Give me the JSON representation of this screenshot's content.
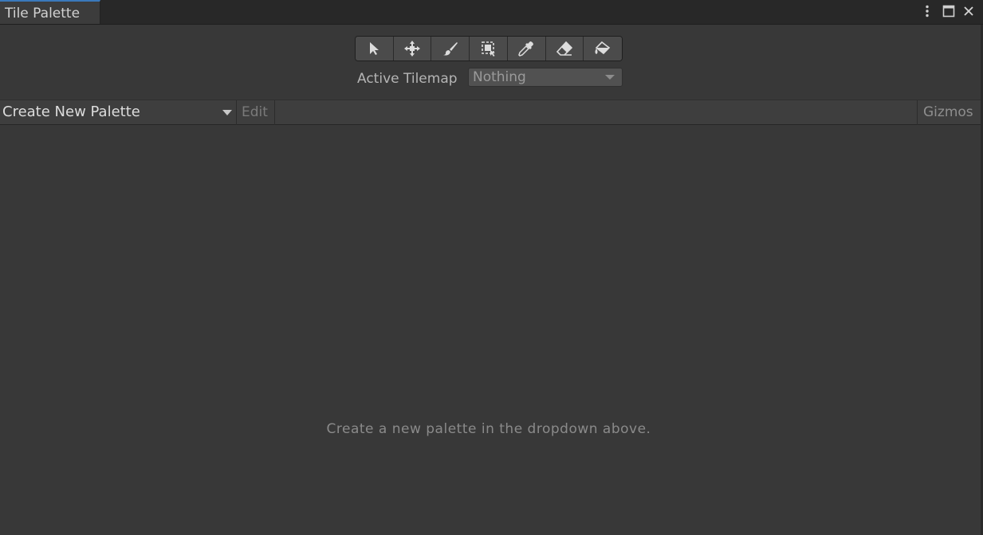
{
  "window": {
    "tab_title": "Tile Palette",
    "controls": [
      "more-options",
      "maximize",
      "close"
    ]
  },
  "tools": [
    {
      "name": "select",
      "icon": "arrow-pointer-icon"
    },
    {
      "name": "move",
      "icon": "move-arrows-icon"
    },
    {
      "name": "paint",
      "icon": "brush-icon"
    },
    {
      "name": "box-fill",
      "icon": "box-select-icon"
    },
    {
      "name": "pick",
      "icon": "eyedropper-icon"
    },
    {
      "name": "erase",
      "icon": "eraser-icon"
    },
    {
      "name": "flood-fill",
      "icon": "paint-bucket-icon"
    }
  ],
  "active_tilemap": {
    "label": "Active Tilemap",
    "value": "Nothing"
  },
  "palette_bar": {
    "palette_select": "Create New Palette",
    "edit": "Edit",
    "gizmos": "Gizmos"
  },
  "main": {
    "empty_message": "Create a new palette in the dropdown above."
  }
}
